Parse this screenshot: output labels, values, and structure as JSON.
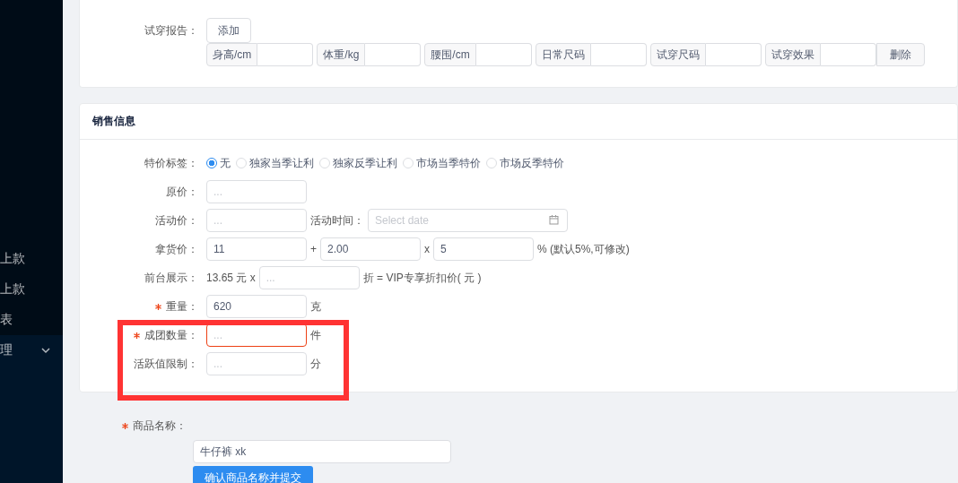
{
  "sidebar": {
    "items": [
      {
        "label": "上款",
        "expandable": false
      },
      {
        "label": "上款",
        "expandable": false
      },
      {
        "label": "表",
        "expandable": false
      },
      {
        "label": "理",
        "expandable": true
      }
    ]
  },
  "size_card": {
    "rows": [
      {
        "label": "试穿报告：",
        "required": false,
        "parts": [
          {
            "kind": "button",
            "label": "添加"
          }
        ]
      }
    ],
    "try_on_fields": [
      {
        "addon": "身高/cm"
      },
      {
        "addon": "体重/kg"
      },
      {
        "addon": "腰围/cm"
      },
      {
        "addon": "日常尺码"
      },
      {
        "addon": "试穿尺码"
      },
      {
        "addon": "试穿效果"
      }
    ],
    "delete_button": "删除"
  },
  "sales_card": {
    "title": "销售信息",
    "rows": [
      {
        "label": "特价标签：",
        "required": false,
        "parts": [
          {
            "kind": "radios",
            "options": [
              {
                "label": "无",
                "selected": true
              },
              {
                "label": "独家当季让利",
                "selected": false
              },
              {
                "label": "独家反季让利",
                "selected": false
              },
              {
                "label": "市场当季特价",
                "selected": false
              },
              {
                "label": "市场反季特价",
                "selected": false
              }
            ]
          }
        ]
      },
      {
        "label": "原价：",
        "required": false,
        "parts": [
          {
            "kind": "input",
            "placeholder": "...",
            "invalid": false
          }
        ]
      },
      {
        "label": "活动价：",
        "required": false,
        "parts": [
          {
            "kind": "input",
            "placeholder": "...",
            "invalid": false
          },
          {
            "kind": "text",
            "text": "活动时间："
          },
          {
            "kind": "date",
            "placeholder": "Select date"
          }
        ]
      },
      {
        "label": "拿货价：",
        "required": false,
        "parts": [
          {
            "kind": "input",
            "value": "11",
            "invalid": false
          },
          {
            "kind": "text",
            "text": "+"
          },
          {
            "kind": "input",
            "value": "2.00",
            "invalid": false
          },
          {
            "kind": "text",
            "text": "x"
          },
          {
            "kind": "input",
            "value": "5",
            "invalid": false
          },
          {
            "kind": "text",
            "text": "% (默认5%,可修改)"
          }
        ]
      },
      {
        "label": "前台展示：",
        "required": false,
        "parts": [
          {
            "kind": "text",
            "text": "13.65 元 x"
          },
          {
            "kind": "input",
            "placeholder": "...",
            "invalid": false
          },
          {
            "kind": "text",
            "text": "折 = VIP专享折扣价( 元 )"
          }
        ]
      },
      {
        "label": "重量：",
        "required": true,
        "parts": [
          {
            "kind": "input",
            "value": "620",
            "invalid": false
          },
          {
            "kind": "text",
            "text": "克"
          }
        ]
      },
      {
        "label": "成团数量：",
        "required": true,
        "parts": [
          {
            "kind": "input",
            "placeholder": "...",
            "invalid": true
          },
          {
            "kind": "text",
            "text": "件"
          }
        ]
      },
      {
        "label": "活跃值限制：",
        "required": false,
        "parts": [
          {
            "kind": "input",
            "placeholder": "...",
            "invalid": false
          },
          {
            "kind": "text",
            "text": "分"
          }
        ]
      }
    ]
  },
  "product_name": {
    "label": "商品名称：",
    "required": true,
    "value": "牛仔裤 xk",
    "submit_button": "确认商品名称并提交"
  }
}
